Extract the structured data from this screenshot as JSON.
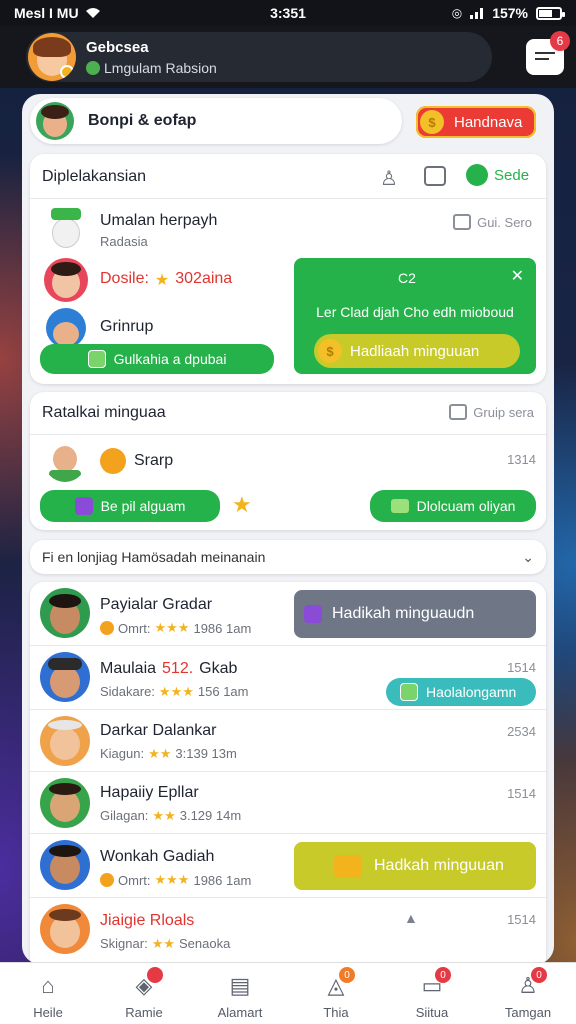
{
  "status_bar": {
    "carrier": "Mesl I MU",
    "time": "3:351",
    "battery": "157%"
  },
  "header": {
    "name": "Gebcsea",
    "subtitle": "Lmgulam Rabsion",
    "message_badge": "6"
  },
  "top_card": {
    "title": "Bonpi & eofap",
    "button": "Handnava"
  },
  "section1": {
    "title": "Diplelakansian",
    "save_label": "Sede",
    "items": [
      {
        "name": "Umalan herpayh",
        "sub": "Radasia",
        "meta": "Gui. Sero"
      },
      {
        "name": "Dosile:",
        "highlight": "302aina"
      },
      {
        "name": "Grinrup"
      }
    ],
    "green_button": "Gulkahia a dpubai",
    "promo": {
      "title": "C2",
      "text": "Ler Clad djah Cho edh mioboud",
      "button": "Hadliaah minguuan"
    }
  },
  "section2": {
    "title": "Ratalkai minguaa",
    "meta": "Gruip sera",
    "item": {
      "name": "Srarp",
      "time": "1314"
    },
    "left_button": "Be pil alguam",
    "right_button": "Dlolcuam oliyan"
  },
  "dropdown": {
    "label": "Fi en lonjiag Hamösadah meinanain"
  },
  "list": [
    {
      "name": "Payialar Gradar",
      "sub_label": "Omrt:",
      "sub_value": "1986 1am",
      "action": "Hadikah minguaudn"
    },
    {
      "name": "Maulaia",
      "name_highlight": "512.",
      "name_rest": "Gkab",
      "sub_label": "Sidakare:",
      "sub_value": "156 1am",
      "time": "1514",
      "action": "Haolalongamn"
    },
    {
      "name": "Darkar Dalankar",
      "sub_label": "Kiagun:",
      "sub_value": "3:139 13m",
      "time": "2534"
    },
    {
      "name": "Hapaiiy Epllar",
      "sub_label": "Gilagan:",
      "sub_value": "3.129 14m",
      "time": "1514"
    },
    {
      "name": "Wonkah Gadiah",
      "sub_label": "Omrt:",
      "sub_value": "1986 1am",
      "action": "Hadkah minguuan"
    },
    {
      "name": "Jiaigie Rloals",
      "sub_label": "Skignar:",
      "sub_value": "Senaoka",
      "time": "1514"
    }
  ],
  "tabs": [
    {
      "label": "Heile",
      "icon": "home-icon"
    },
    {
      "label": "Ramie",
      "icon": "tag-icon",
      "badge": ""
    },
    {
      "label": "Alamart",
      "icon": "document-icon"
    },
    {
      "label": "Thia",
      "icon": "bag-icon",
      "badge": "0"
    },
    {
      "label": "Siitua",
      "icon": "chat-icon",
      "badge": "0"
    },
    {
      "label": "Tamgan",
      "icon": "person-icon",
      "badge": "0"
    }
  ],
  "colors": {
    "green": "#25b24a",
    "red": "#ec3b35",
    "yellow": "#c8ca2a",
    "teal": "#3bbcbc",
    "slate": "#6f7787"
  }
}
